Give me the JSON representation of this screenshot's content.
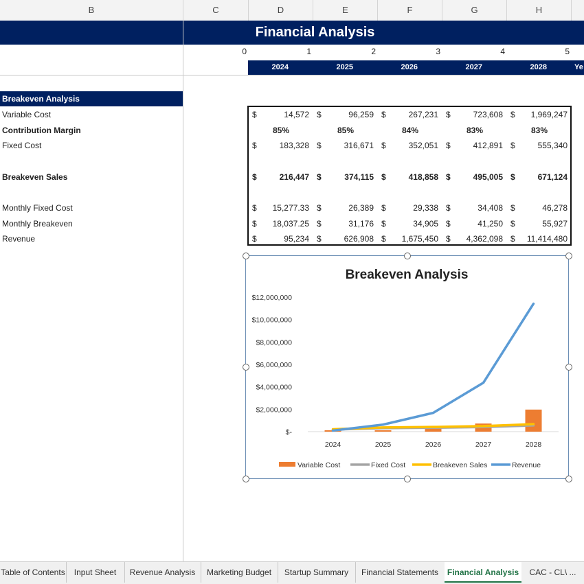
{
  "columns": [
    "B",
    "C",
    "D",
    "E",
    "F",
    "G",
    "H"
  ],
  "sheet_title": "Financial Analysis",
  "year_index": [
    "0",
    "1",
    "2",
    "3",
    "4",
    "5"
  ],
  "years": [
    "2024",
    "2025",
    "2026",
    "2027",
    "2028"
  ],
  "year_overflow": "Ye",
  "section": {
    "header": "Breakeven Analysis",
    "rows": [
      {
        "label": "Variable Cost",
        "bold": false,
        "values": [
          "14,572",
          "96,259",
          "267,231",
          "723,608",
          "1,969,247"
        ],
        "currency": true
      },
      {
        "label": "Contribution Margin",
        "bold": true,
        "values": [
          "85%",
          "85%",
          "84%",
          "83%",
          "83%"
        ],
        "currency": false
      },
      {
        "label": "Fixed Cost",
        "bold": false,
        "values": [
          "183,328",
          "316,671",
          "352,051",
          "412,891",
          "555,340"
        ],
        "currency": true
      },
      {
        "label": "Breakeven Sales",
        "bold": true,
        "values": [
          "216,447",
          "374,115",
          "418,858",
          "495,005",
          "671,124"
        ],
        "currency": true
      },
      {
        "label": "Monthly Fixed Cost",
        "bold": false,
        "values": [
          "15,277.33",
          "26,389",
          "29,338",
          "34,408",
          "46,278"
        ],
        "currency": true
      },
      {
        "label": "Monthly Breakeven",
        "bold": false,
        "values": [
          "18,037.25",
          "31,176",
          "34,905",
          "41,250",
          "55,927"
        ],
        "currency": true
      },
      {
        "label": "Revenue",
        "bold": false,
        "values": [
          "95,234",
          "626,908",
          "1,675,450",
          "4,362,098",
          "11,414,480"
        ],
        "currency": true
      }
    ],
    "currency_symbol": "$"
  },
  "chart_data": {
    "type": "line",
    "title": "Breakeven Analysis",
    "categories": [
      "2024",
      "2025",
      "2026",
      "2027",
      "2028"
    ],
    "ylim": [
      0,
      12000000
    ],
    "yticks": [
      0,
      2000000,
      4000000,
      6000000,
      8000000,
      10000000,
      12000000
    ],
    "ytick_labels": [
      "$-",
      "$2,000,000",
      "$4,000,000",
      "$6,000,000",
      "$8,000,000",
      "$10,000,000",
      "$12,000,000"
    ],
    "xlabel": "",
    "ylabel": "",
    "grid": false,
    "legend": "bottom",
    "series": [
      {
        "name": "Variable Cost",
        "kind": "bar",
        "color": "#ed7d31",
        "values": [
          14572,
          96259,
          267231,
          723608,
          1969247
        ]
      },
      {
        "name": "Fixed Cost",
        "kind": "line",
        "color": "#a5a5a5",
        "values": [
          183328,
          316671,
          352051,
          412891,
          555340
        ]
      },
      {
        "name": "Breakeven Sales",
        "kind": "line",
        "color": "#ffc000",
        "values": [
          216447,
          374115,
          418858,
          495005,
          671124
        ]
      },
      {
        "name": "Revenue",
        "kind": "line",
        "color": "#5b9bd5",
        "values": [
          95234,
          626908,
          1675450,
          4362098,
          11414480
        ]
      }
    ]
  },
  "sheet_tabs": [
    {
      "label": "Table of Contents",
      "active": false
    },
    {
      "label": "Input Sheet",
      "active": false
    },
    {
      "label": "Revenue Analysis",
      "active": false
    },
    {
      "label": "Marketing Budget",
      "active": false
    },
    {
      "label": "Startup Summary",
      "active": false
    },
    {
      "label": "Financial Statements",
      "active": false
    },
    {
      "label": "Financial Analysis",
      "active": true
    },
    {
      "label": "CAC - CL\\ ...",
      "active": false
    }
  ]
}
